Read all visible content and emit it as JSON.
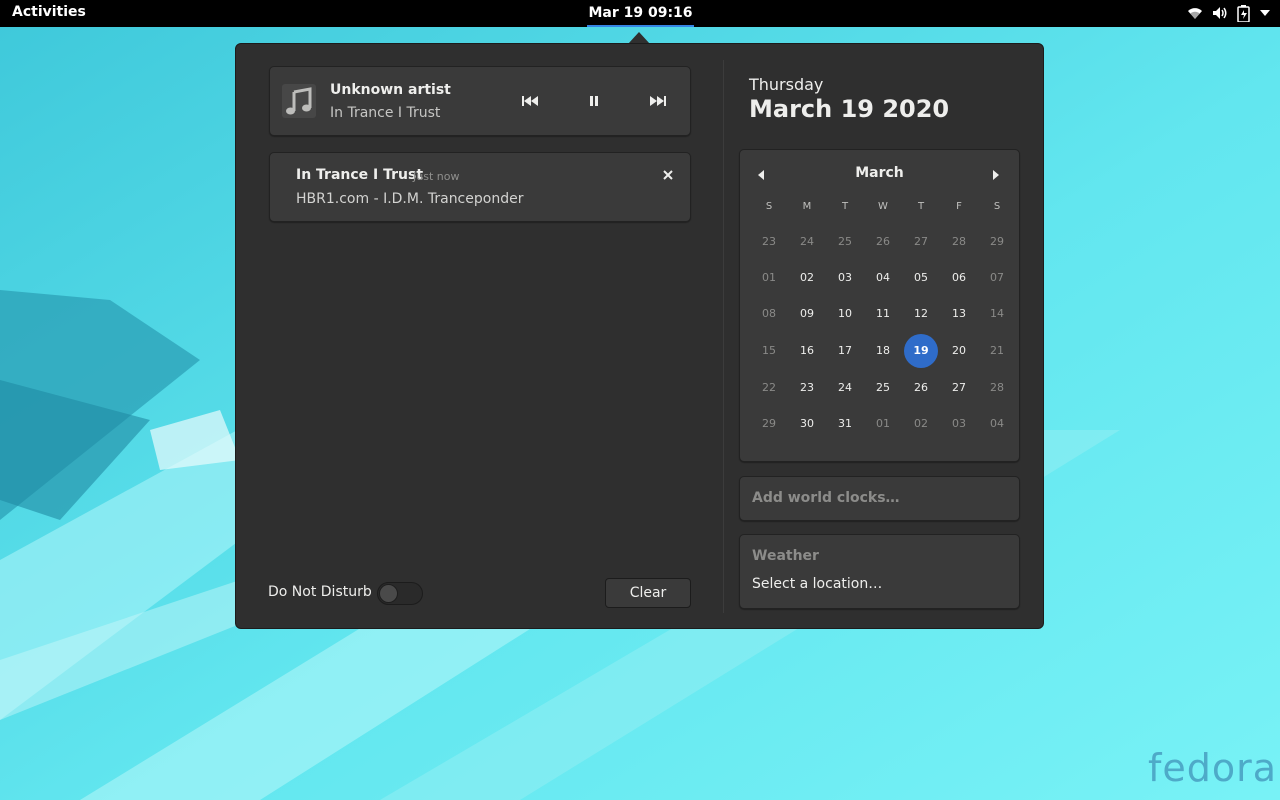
{
  "topbar": {
    "activities": "Activities",
    "clock": "Mar 19  09:16",
    "icons": [
      "wifi-icon",
      "volume-icon",
      "battery-icon",
      "menu-arrow-icon"
    ]
  },
  "media": {
    "artist": "Unknown artist",
    "track": "In Trance I Trust",
    "controls": [
      "previous-icon",
      "pause-icon",
      "next-icon"
    ]
  },
  "notification": {
    "title": "In Trance I Trust",
    "time": "Just now",
    "body": "HBR1.com - I.D.M. Tranceponder"
  },
  "dnd": {
    "label": "Do Not Disturb",
    "enabled": false
  },
  "clear_label": "Clear",
  "date": {
    "day_name": "Thursday",
    "full_date": "March 19 2020"
  },
  "calendar": {
    "month": "March",
    "weekdays": [
      "S",
      "M",
      "T",
      "W",
      "T",
      "F",
      "S"
    ],
    "weeks": [
      [
        "23",
        "24",
        "25",
        "26",
        "27",
        "28",
        "29"
      ],
      [
        "01",
        "02",
        "03",
        "04",
        "05",
        "06",
        "07"
      ],
      [
        "08",
        "09",
        "10",
        "11",
        "12",
        "13",
        "14"
      ],
      [
        "15",
        "16",
        "17",
        "18",
        "19",
        "20",
        "21"
      ],
      [
        "22",
        "23",
        "24",
        "25",
        "26",
        "27",
        "28"
      ],
      [
        "29",
        "30",
        "31",
        "01",
        "02",
        "03",
        "04"
      ]
    ],
    "today": "19"
  },
  "world_clocks": "Add world clocks…",
  "weather": {
    "title": "Weather",
    "location": "Select a location…"
  },
  "logo_text": "fedora",
  "colors": {
    "accent": "#2f6cc9",
    "panel": "#2f2f2f",
    "wallpaper": "#5fe0ea"
  }
}
